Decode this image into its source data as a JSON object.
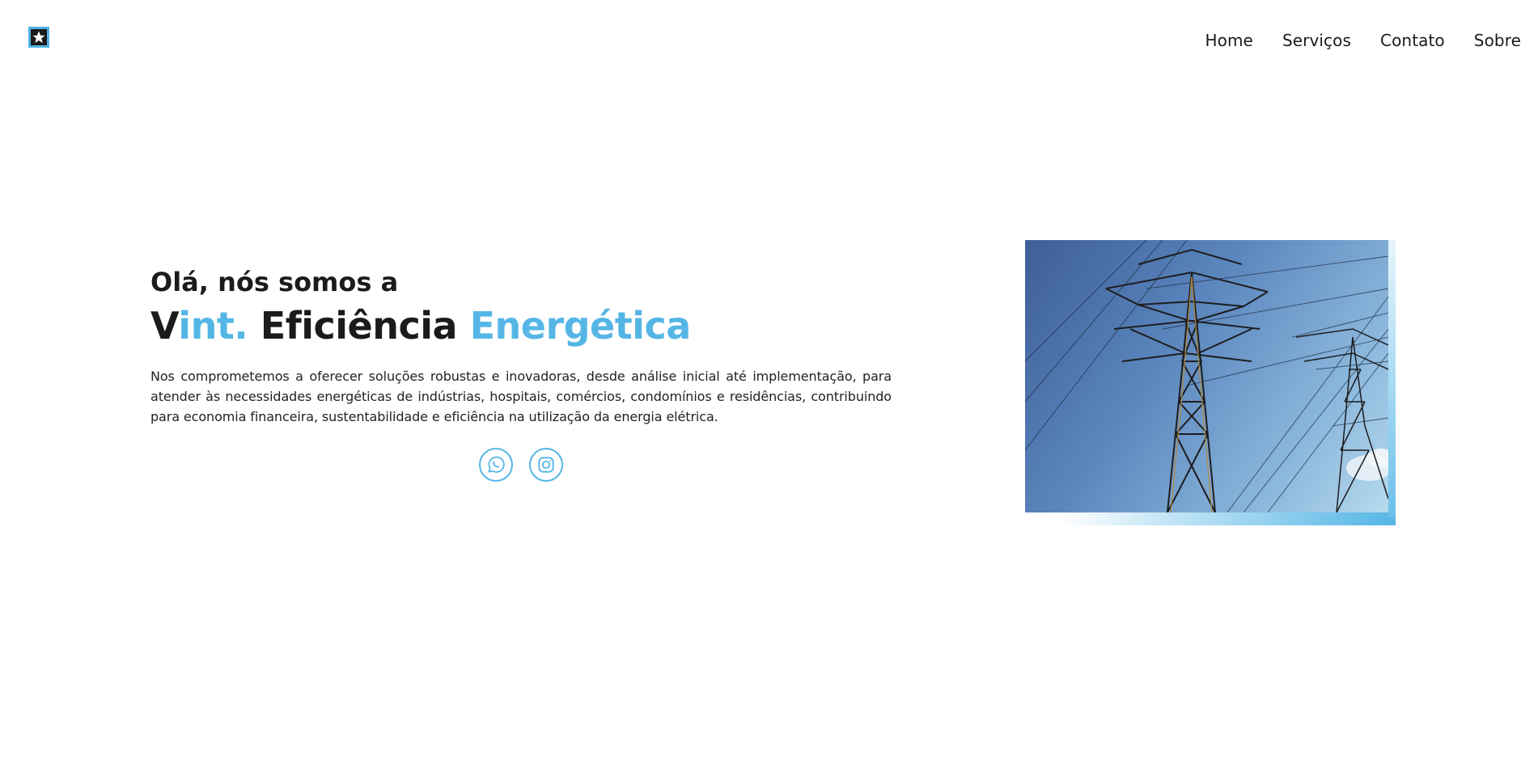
{
  "header": {
    "logo_icon": "star-logo-icon",
    "nav": [
      {
        "label": "Home"
      },
      {
        "label": "Serviços"
      },
      {
        "label": "Contato"
      },
      {
        "label": "Sobre"
      }
    ]
  },
  "hero": {
    "greeting": "Olá, nós somos a",
    "headline": {
      "part1": "V",
      "part2": "int.",
      "part3": "Eficiência",
      "part4": "Energética"
    },
    "description": "Nos comprometemos a oferecer soluções robustas e inovadoras, desde análise inicial até implementação, para atender às necessidades energéticas de indústrias, hospitais, comércios, condomínios e residências, contribuindo para economia financeira, sustentabilidade e eficiência na utilização da energia elétrica.",
    "socials": [
      {
        "icon": "whatsapp-icon"
      },
      {
        "icon": "instagram-icon"
      }
    ],
    "image": {
      "subject": "power-transmission-towers"
    }
  },
  "colors": {
    "accent": "#55b6e6",
    "text": "#1b1b1b",
    "background": "#ffffff"
  }
}
